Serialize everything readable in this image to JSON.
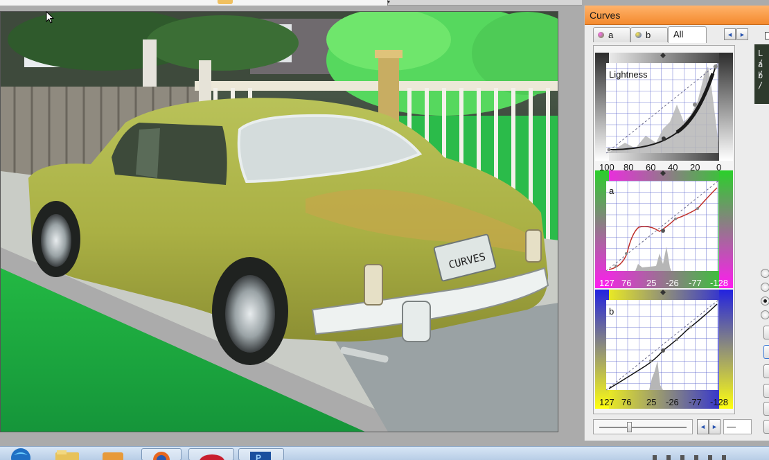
{
  "curves_panel": {
    "title": "Curves",
    "tabs": [
      {
        "label": "a",
        "icon": "color-channel-icon"
      },
      {
        "label": "b",
        "icon": "color-channel-icon"
      },
      {
        "label": "All"
      }
    ],
    "prev_label": "◄",
    "next_label": "►",
    "lightness": {
      "label": "Lightness",
      "ticks": [
        "100",
        "80",
        "60",
        "40",
        "20",
        "0"
      ]
    },
    "a": {
      "label": "a",
      "ticks": [
        "127",
        "76",
        "25",
        "-26",
        "-77",
        "-128"
      ]
    },
    "b": {
      "label": "b",
      "ticks": [
        "127",
        "76",
        "25",
        "-26",
        "-77",
        "-128"
      ]
    },
    "side_readout": [
      "L /",
      "a /",
      "b /"
    ],
    "value_field": "—"
  },
  "image": {
    "plate_text": "CURVES"
  },
  "colors": {
    "title_bar": "#f48a2e",
    "grid": "#4a55c8",
    "curve_lightness": "#1a1a1a",
    "curve_a": "#c0302a",
    "curve_b": "#111111"
  }
}
